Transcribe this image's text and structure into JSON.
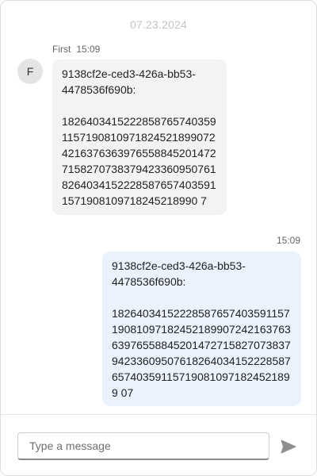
{
  "chat": {
    "date_separator": "07.23.2024",
    "messages": [
      {
        "direction": "incoming",
        "sender": "First",
        "avatar_initial": "F",
        "time": "15:09",
        "text": "9138cf2e-ced3-426a-bb53-\n4478536f690b:\n\n182640341522285876574035911571908109718245218990724216376363976558845201472715827073837942336095076182640341522285876574035911571908109718245218990 7"
      },
      {
        "direction": "outgoing",
        "time": "15:09",
        "text": "9138cf2e-ced3-426a-bb53-\n4478536f690b:\n\n18264034152228587657403591157190810971824521899072421637636397655884520147271582707383794233609507618264034152228587657403591157190810971824521899 07"
      }
    ]
  },
  "composer": {
    "placeholder": "Type a message",
    "value": "",
    "send_icon": "send-icon"
  },
  "colors": {
    "incoming_bubble": "#f3f3f3",
    "outgoing_bubble": "#eaf2fd",
    "date_text": "#c4c4c4",
    "send_icon": "#8f8f8f"
  }
}
